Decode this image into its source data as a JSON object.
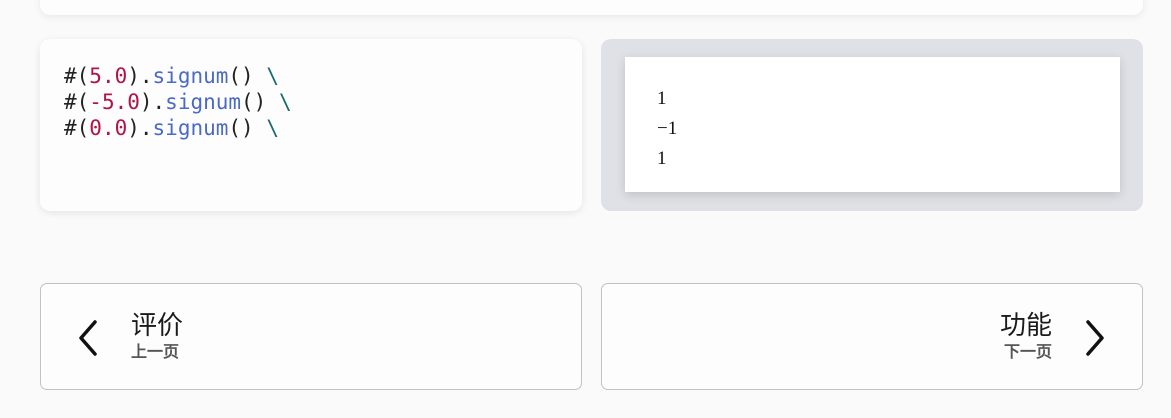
{
  "code": {
    "lines": [
      [
        {
          "t": "#(",
          "c": "plain"
        },
        {
          "t": "5.0",
          "c": "num"
        },
        {
          "t": ").",
          "c": "plain"
        },
        {
          "t": "signum",
          "c": "fn"
        },
        {
          "t": "() ",
          "c": "plain"
        },
        {
          "t": "\\",
          "c": "esc"
        }
      ],
      [
        {
          "t": "#(",
          "c": "plain"
        },
        {
          "t": "-5.0",
          "c": "num"
        },
        {
          "t": ").",
          "c": "plain"
        },
        {
          "t": "signum",
          "c": "fn"
        },
        {
          "t": "() ",
          "c": "plain"
        },
        {
          "t": "\\",
          "c": "esc"
        }
      ],
      [
        {
          "t": "#(",
          "c": "plain"
        },
        {
          "t": "0.0",
          "c": "num"
        },
        {
          "t": ").",
          "c": "plain"
        },
        {
          "t": "signum",
          "c": "fn"
        },
        {
          "t": "() ",
          "c": "plain"
        },
        {
          "t": "\\",
          "c": "esc"
        }
      ]
    ]
  },
  "preview": {
    "lines": [
      "1",
      "−1",
      "1"
    ]
  },
  "nav": {
    "prev": {
      "title": "评价",
      "sub": "上一页",
      "icon": "chevron-left-icon"
    },
    "next": {
      "title": "功能",
      "sub": "下一页",
      "icon": "chevron-right-icon"
    }
  },
  "colors": {
    "number": "#b0144a",
    "function": "#4b69c6",
    "escape": "#1a6b6b",
    "preview_bg": "#e0e1e6"
  }
}
